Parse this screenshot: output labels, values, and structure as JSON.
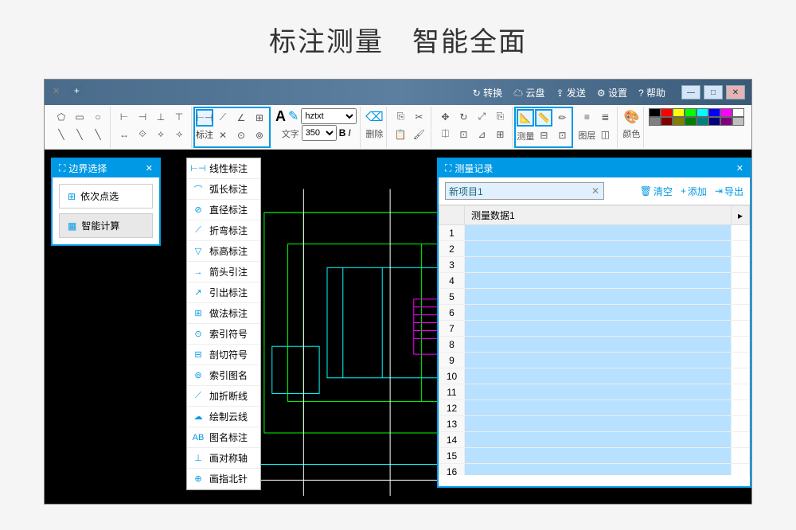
{
  "banner": {
    "title1": "标注测量",
    "title2": "智能全面"
  },
  "titlebar": {
    "menu": {
      "convert": "转换",
      "cloud": "云盘",
      "send": "发送",
      "settings": "设置",
      "help": "帮助"
    },
    "win": {
      "min": "—",
      "max": "□",
      "close": "✕"
    }
  },
  "toolbar": {
    "annotate_label": "标注",
    "text_label": "文字",
    "font": "hztxt",
    "font_size": "350",
    "delete_label": "删除",
    "measure_label": "测量",
    "layer_label": "图层",
    "color_label": "颜色"
  },
  "panel_left": {
    "title": "边界选择",
    "btn1": "依次点选",
    "btn2": "智能计算"
  },
  "dropdown": {
    "items": [
      "线性标注",
      "弧长标注",
      "直径标注",
      "折弯标注",
      "标高标注",
      "箭头引注",
      "引出标注",
      "做法标注",
      "索引符号",
      "剖切符号",
      "索引图名",
      "加折断线",
      "绘制云线",
      "图名标注",
      "画对称轴",
      "画指北针"
    ]
  },
  "panel_right": {
    "title": "测量记录",
    "project": "新项目1",
    "clear": "清空",
    "add": "添加",
    "export": "导出",
    "col_header": "测量数据1",
    "rows": [
      1,
      2,
      3,
      4,
      5,
      6,
      7,
      8,
      9,
      10,
      11,
      12,
      13,
      14,
      15,
      16
    ]
  },
  "colors": {
    "palette": [
      "#000000",
      "#ff0000",
      "#ffff00",
      "#00ff00",
      "#00ffff",
      "#0000ff",
      "#ff00ff",
      "#ffffff",
      "#808080",
      "#800000",
      "#808000",
      "#008000",
      "#008080",
      "#000080",
      "#800080",
      "#c0c0c0"
    ]
  }
}
